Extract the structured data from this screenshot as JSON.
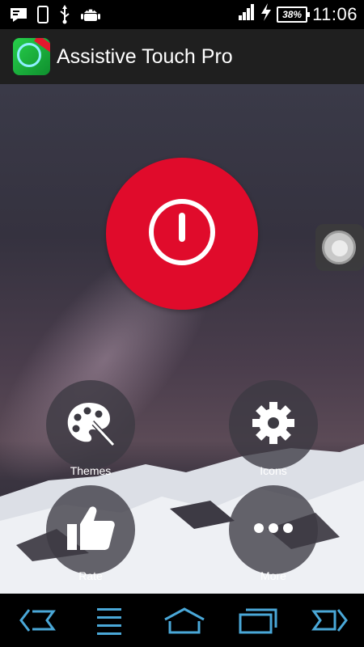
{
  "status_bar": {
    "icons_left": [
      "message-icon",
      "phone-outline-icon",
      "usb-icon",
      "android-icon"
    ],
    "icons_right": [
      "signal-icon",
      "charging-icon"
    ],
    "battery": "38%",
    "time": "11:06"
  },
  "app_bar": {
    "title": "Assistive Touch Pro",
    "icon": "app-logo-icon"
  },
  "main": {
    "power_icon": "power-icon",
    "menu": [
      {
        "label": "Themes",
        "icon": "palette-icon"
      },
      {
        "label": "Icons",
        "icon": "gear-icon"
      },
      {
        "label": "Rate",
        "icon": "thumbs-up-icon"
      },
      {
        "label": "More",
        "icon": "more-dots-icon"
      }
    ],
    "colors": {
      "power": "#e00b2b",
      "menu_circle": "#3c3a42"
    }
  },
  "nav_bar": {
    "icons": [
      "nav-back-icon",
      "nav-menu-icon",
      "nav-home-icon",
      "nav-recents-icon",
      "nav-forward-icon"
    ],
    "color": "#4aa8d8"
  }
}
